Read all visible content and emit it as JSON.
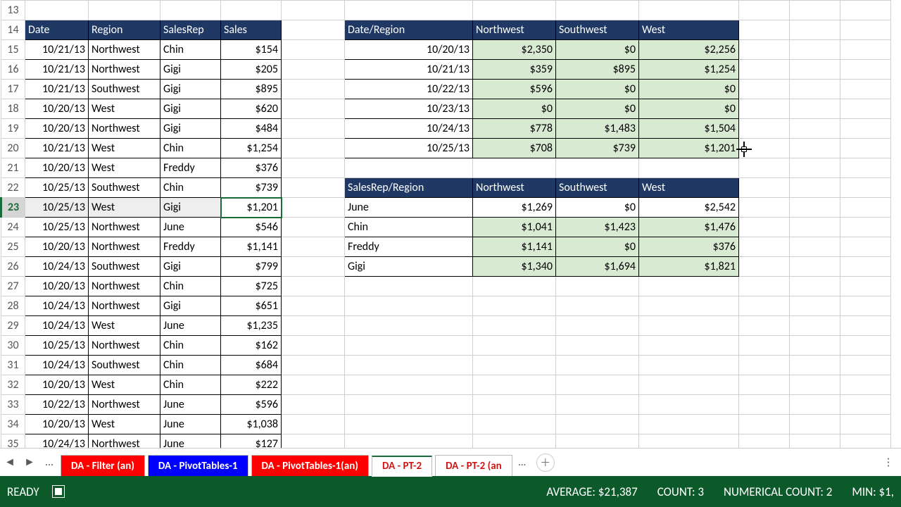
{
  "rows_start": 13,
  "left_headers": {
    "date": "Date",
    "region": "Region",
    "salesrep": "SalesRep",
    "sales": "Sales"
  },
  "left_rows": [
    {
      "date": "10/21/13",
      "region": "Northwest",
      "rep": "Chin",
      "sales": "$154"
    },
    {
      "date": "10/21/13",
      "region": "Northwest",
      "rep": "Gigi",
      "sales": "$205"
    },
    {
      "date": "10/21/13",
      "region": "Southwest",
      "rep": "Gigi",
      "sales": "$895"
    },
    {
      "date": "10/20/13",
      "region": "West",
      "rep": "Gigi",
      "sales": "$620"
    },
    {
      "date": "10/20/13",
      "region": "Northwest",
      "rep": "Gigi",
      "sales": "$484"
    },
    {
      "date": "10/21/13",
      "region": "West",
      "rep": "Chin",
      "sales": "$1,254"
    },
    {
      "date": "10/20/13",
      "region": "West",
      "rep": "Freddy",
      "sales": "$376"
    },
    {
      "date": "10/25/13",
      "region": "Southwest",
      "rep": "Chin",
      "sales": "$739"
    },
    {
      "date": "10/25/13",
      "region": "West",
      "rep": "Gigi",
      "sales": "$1,201"
    },
    {
      "date": "10/25/13",
      "region": "Northwest",
      "rep": "June",
      "sales": "$546"
    },
    {
      "date": "10/20/13",
      "region": "Northwest",
      "rep": "Freddy",
      "sales": "$1,141"
    },
    {
      "date": "10/24/13",
      "region": "Southwest",
      "rep": "Gigi",
      "sales": "$799"
    },
    {
      "date": "10/20/13",
      "region": "Northwest",
      "rep": "Chin",
      "sales": "$725"
    },
    {
      "date": "10/24/13",
      "region": "Northwest",
      "rep": "Gigi",
      "sales": "$651"
    },
    {
      "date": "10/24/13",
      "region": "West",
      "rep": "June",
      "sales": "$1,235"
    },
    {
      "date": "10/25/13",
      "region": "Northwest",
      "rep": "Chin",
      "sales": "$162"
    },
    {
      "date": "10/24/13",
      "region": "Southwest",
      "rep": "Chin",
      "sales": "$684"
    },
    {
      "date": "10/20/13",
      "region": "West",
      "rep": "Chin",
      "sales": "$222"
    },
    {
      "date": "10/22/13",
      "region": "Northwest",
      "rep": "June",
      "sales": "$596"
    },
    {
      "date": "10/20/13",
      "region": "West",
      "rep": "June",
      "sales": "$1,038"
    },
    {
      "date": "10/24/13",
      "region": "Northwest",
      "rep": "June",
      "sales": "$127"
    }
  ],
  "pivot1": {
    "corner": "Date/Region",
    "cols": [
      "Northwest",
      "Southwest",
      "West"
    ],
    "rows": [
      {
        "label": "10/20/13",
        "vals": [
          "$2,350",
          "$0",
          "$2,256"
        ]
      },
      {
        "label": "10/21/13",
        "vals": [
          "$359",
          "$895",
          "$1,254"
        ]
      },
      {
        "label": "10/22/13",
        "vals": [
          "$596",
          "$0",
          "$0"
        ]
      },
      {
        "label": "10/23/13",
        "vals": [
          "$0",
          "$0",
          "$0"
        ]
      },
      {
        "label": "10/24/13",
        "vals": [
          "$778",
          "$1,483",
          "$1,504"
        ]
      },
      {
        "label": "10/25/13",
        "vals": [
          "$708",
          "$739",
          "$1,201"
        ]
      }
    ]
  },
  "pivot2": {
    "corner": "SalesRep/Region",
    "cols": [
      "Northwest",
      "Southwest",
      "West"
    ],
    "rows": [
      {
        "label": "June",
        "vals": [
          "$1,269",
          "$0",
          "$2,542"
        ]
      },
      {
        "label": "Chin",
        "vals": [
          "$1,041",
          "$1,423",
          "$1,476"
        ]
      },
      {
        "label": "Freddy",
        "vals": [
          "$1,141",
          "$0",
          "$376"
        ]
      },
      {
        "label": "Gigi",
        "vals": [
          "$1,340",
          "$1,694",
          "$1,821"
        ]
      }
    ]
  },
  "tabs": [
    {
      "label": "DA - Filter (an)",
      "cls": "red"
    },
    {
      "label": "DA - PivotTables-1",
      "cls": "blue"
    },
    {
      "label": "DA - PivotTables-1(an)",
      "cls": "red"
    },
    {
      "label": "DA - PT-2",
      "cls": "active"
    },
    {
      "label": "DA - PT-2 (an",
      "cls": "inactive-white"
    }
  ],
  "status": {
    "ready": "READY",
    "avg": "AVERAGE: $21,387",
    "count": "COUNT: 3",
    "numcount": "NUMERICAL COUNT: 2",
    "min": "MIN: $1,"
  },
  "chart_data": [
    {
      "type": "table",
      "title": "Date/Region",
      "categories": [
        "Northwest",
        "Southwest",
        "West"
      ],
      "series": [
        {
          "name": "10/20/13",
          "values": [
            2350,
            0,
            2256
          ]
        },
        {
          "name": "10/21/13",
          "values": [
            359,
            895,
            1254
          ]
        },
        {
          "name": "10/22/13",
          "values": [
            596,
            0,
            0
          ]
        },
        {
          "name": "10/23/13",
          "values": [
            0,
            0,
            0
          ]
        },
        {
          "name": "10/24/13",
          "values": [
            778,
            1483,
            1504
          ]
        },
        {
          "name": "10/25/13",
          "values": [
            708,
            739,
            1201
          ]
        }
      ]
    },
    {
      "type": "table",
      "title": "SalesRep/Region",
      "categories": [
        "Northwest",
        "Southwest",
        "West"
      ],
      "series": [
        {
          "name": "June",
          "values": [
            1269,
            0,
            2542
          ]
        },
        {
          "name": "Chin",
          "values": [
            1041,
            1423,
            1476
          ]
        },
        {
          "name": "Freddy",
          "values": [
            1141,
            0,
            376
          ]
        },
        {
          "name": "Gigi",
          "values": [
            1340,
            1694,
            1821
          ]
        }
      ]
    }
  ]
}
